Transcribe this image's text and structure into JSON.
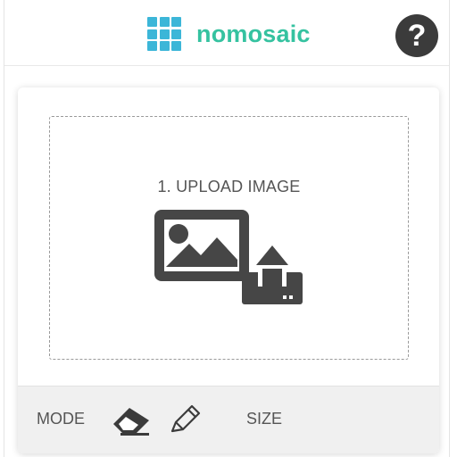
{
  "header": {
    "logo_text": "nomosaic",
    "help_icon": "question-circle-icon",
    "help_symbol": "?",
    "brand_color": "#35c2a0",
    "logo_grid_color": "#3cb6d8"
  },
  "upload": {
    "label": "1. UPLOAD IMAGE",
    "icon": "image-upload-icon"
  },
  "footer": {
    "mode_label": "MODE",
    "size_label": "SIZE",
    "eraser_icon": "eraser-icon",
    "pencil_icon": "pencil-icon"
  }
}
